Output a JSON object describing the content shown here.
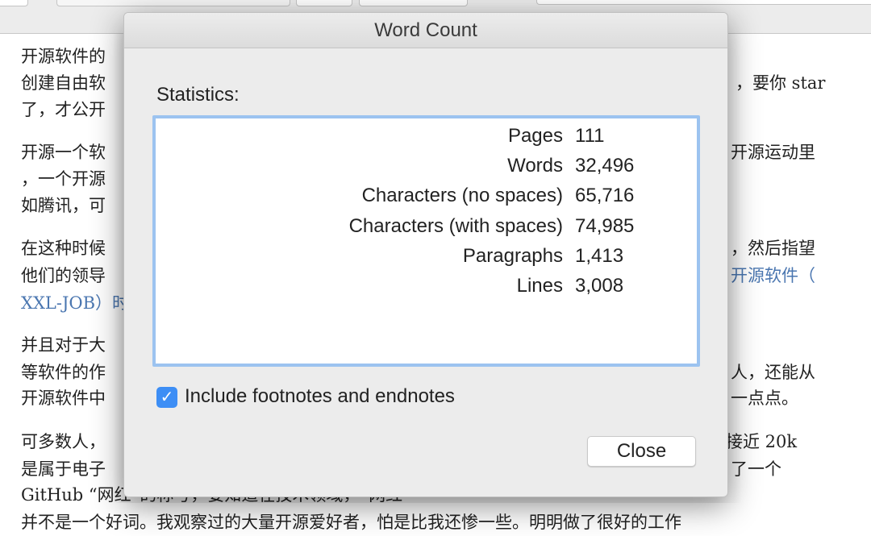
{
  "document": {
    "lines_left": [
      "开源软件的",
      "创建自由软",
      "了，才公开",
      "开源一个软",
      "，一个开源",
      "如腾讯，可",
      "在这种时候",
      "他们的领导",
      "XXL-JOB）时",
      "并且对于大",
      "等软件的作",
      "开源软件中",
      "可多数人，",
      "是属于电子",
      "GitHub “网红”的称号，要知道在技术领域，“网红”",
      "并不是一个好词。我观察过的大量开源爱好者，怕是比我还惨一些。明明做了很好的工作"
    ],
    "lines_right": [
      "，要你 star",
      "开源运动里",
      "，然后指望",
      "开源软件（",
      "人，还能从",
      "一点点。",
      "接近 20k",
      "了一个"
    ]
  },
  "dialog": {
    "title": "Word Count",
    "statistics_label": "Statistics:",
    "stats": [
      {
        "label": "Pages",
        "value": "111"
      },
      {
        "label": "Words",
        "value": "32,496"
      },
      {
        "label": "Characters (no spaces)",
        "value": "65,716"
      },
      {
        "label": "Characters (with spaces)",
        "value": "74,985"
      },
      {
        "label": "Paragraphs",
        "value": "1,413"
      },
      {
        "label": "Lines",
        "value": "3,008"
      }
    ],
    "include_footnotes_label": "Include footnotes and endnotes",
    "include_footnotes_checked": true,
    "close_label": "Close"
  }
}
